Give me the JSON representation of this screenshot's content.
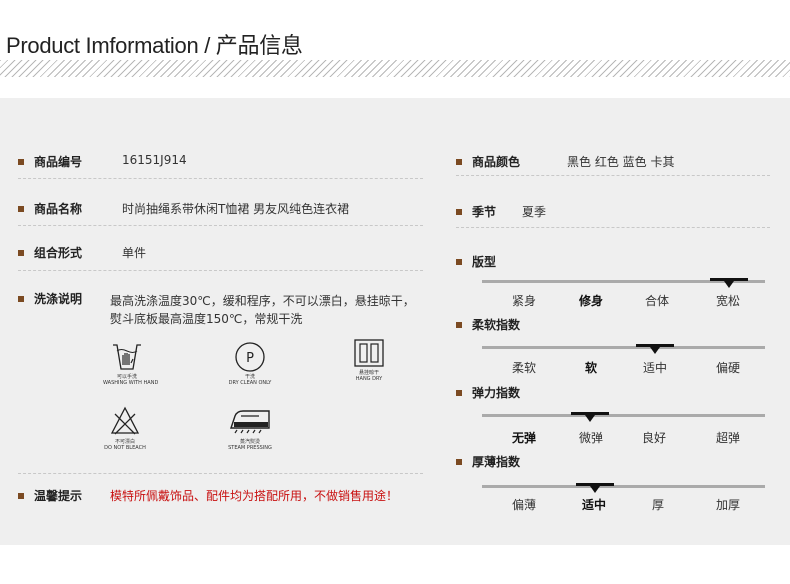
{
  "header": {
    "title": "Product Imformation / 产品信息"
  },
  "left": {
    "code": {
      "label": "商品编号",
      "value": "16151J914"
    },
    "name": {
      "label": "商品名称",
      "value": "时尚抽绳系带休闲T恤裙 男友风纯色连衣裙"
    },
    "combo": {
      "label": "组合形式",
      "value": "单件"
    },
    "wash": {
      "label": "洗涤说明",
      "line1": "最高洗涤温度30℃，缓和程序，不可以漂白，悬挂晾干，",
      "line2": "熨斗底板最高温度150℃，常规干洗",
      "icons": [
        {
          "icon": "hand-wash-icon",
          "cn": "可以手洗",
          "en": "WASHING WITH HAND"
        },
        {
          "icon": "dry-clean-icon",
          "cn": "干洗",
          "en": "DRY CLEAN ONLY",
          "glyph": "P"
        },
        {
          "icon": "hang-dry-icon",
          "cn": "悬挂晾干",
          "en": "HANG DRY"
        },
        {
          "icon": "no-bleach-icon",
          "cn": "不可漂白",
          "en": "DO NOT BLEACH"
        },
        {
          "icon": "steam-iron-icon",
          "cn": "蒸汽熨烫",
          "en": "STEAM PRESSING"
        }
      ]
    },
    "tips": {
      "label": "温馨提示",
      "value": "模特所佩戴饰品、配件均为搭配所用，不做销售用途！"
    }
  },
  "right": {
    "color": {
      "label": "商品颜色",
      "value": "黑色 红色 蓝色 卡其"
    },
    "season": {
      "label": "季节",
      "value": "夏季"
    },
    "scales": [
      {
        "label": "版型",
        "options": [
          "紧身",
          "修身",
          "合体",
          "宽松"
        ],
        "bold_index": 1,
        "selected_index": 3
      },
      {
        "label": "柔软指数",
        "options": [
          "柔软",
          "软",
          "适中",
          "偏硬"
        ],
        "bold_index": 1,
        "selected_index": 2
      },
      {
        "label": "弹力指数",
        "options": [
          "无弹",
          "微弹",
          "良好",
          "超弹"
        ],
        "bold_index": 0,
        "selected_index": 1
      },
      {
        "label": "厚薄指数",
        "options": [
          "偏薄",
          "适中",
          "厚",
          "加厚"
        ],
        "bold_index": 1,
        "selected_index": 1
      }
    ]
  },
  "colors": {
    "accent_bullet": "#7b4a22",
    "warning_text": "#c81010",
    "panel_bg": "#efefef"
  }
}
